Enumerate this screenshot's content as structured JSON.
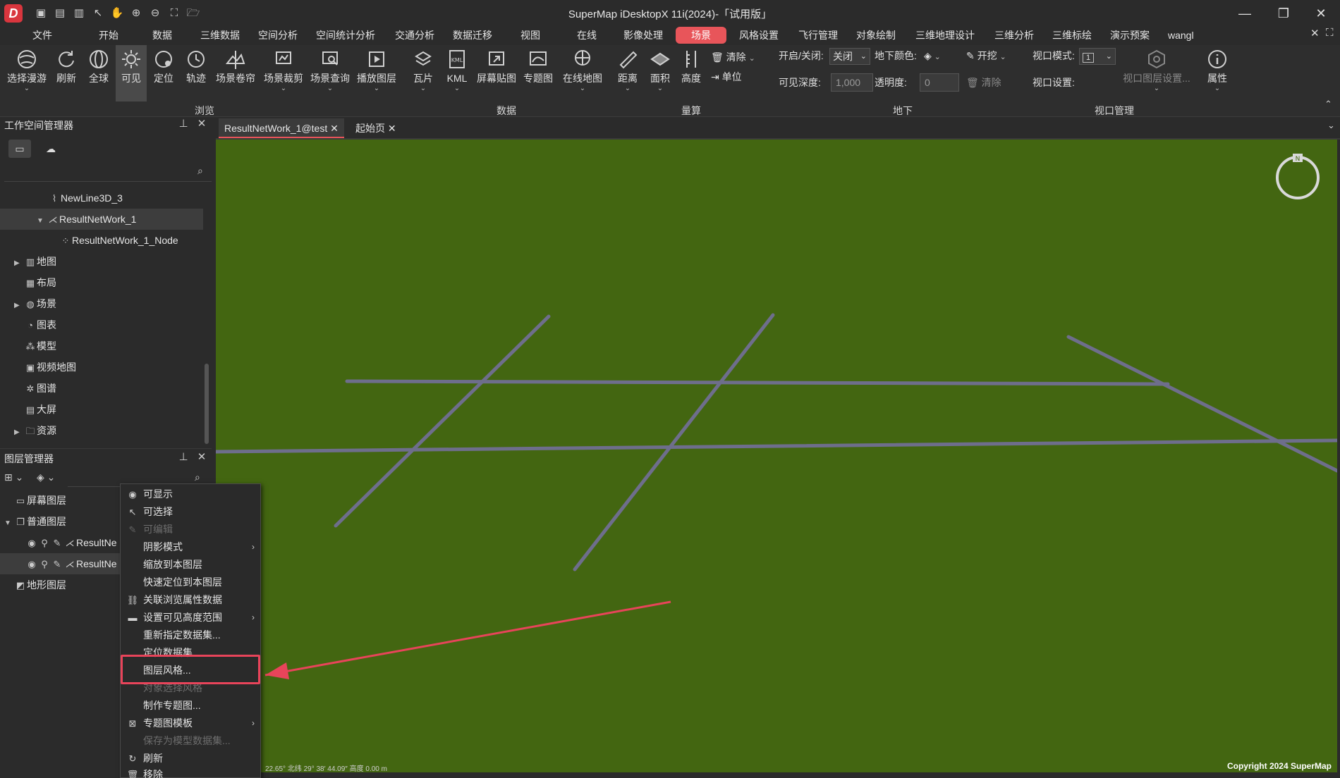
{
  "window": {
    "title": "SuperMap iDesktopX 11i(2024)-「试用版」"
  },
  "menu": {
    "tabs": [
      "文件",
      "开始",
      "数据",
      "三维数据",
      "空间分析",
      "空间统计分析",
      "交通分析",
      "数据迁移",
      "视图",
      "在线",
      "影像处理",
      "场景",
      "风格设置",
      "飞行管理",
      "对象绘制",
      "三维地理设计",
      "三维分析",
      "三维标绘",
      "演示预案"
    ],
    "active": "场景",
    "user": "wangl"
  },
  "ribbon": {
    "browse": {
      "group": "浏览",
      "buttons": [
        "选择漫游",
        "刷新",
        "全球",
        "可见",
        "定位",
        "轨迹",
        "场景卷帘",
        "场景裁剪",
        "场景查询",
        "播放图层"
      ]
    },
    "data": {
      "group": "数据",
      "buttons": [
        "瓦片",
        "KML",
        "屏幕贴图",
        "专题图",
        "在线地图"
      ]
    },
    "measure": {
      "group": "量算",
      "buttons": [
        "距离",
        "面积",
        "高度"
      ],
      "clear": "清除",
      "unit": "单位"
    },
    "underground": {
      "group": "地下",
      "toggle_label": "开启/关闭:",
      "toggle_value": "关闭",
      "color_label": "地下颜色:",
      "excavate": "开挖",
      "depth_label": "可见深度:",
      "depth_value": "1,000",
      "opacity_label": "透明度:",
      "opacity_value": "0",
      "clear": "清除"
    },
    "viewport": {
      "group": "视口管理",
      "mode_label": "视口模式:",
      "mode_value": "1",
      "settings_label": "视口设置:",
      "layer_settings": "视口图层设置..."
    },
    "properties": "属性"
  },
  "workspace": {
    "title": "工作空间管理器",
    "items": [
      "NewLine3D_3",
      "ResultNetWork_1",
      "ResultNetWork_1_Node",
      "地图",
      "布局",
      "场景",
      "图表",
      "模型",
      "视频地图",
      "图谱",
      "大屏",
      "资源"
    ]
  },
  "layers": {
    "title": "图层管理器",
    "items": [
      "屏幕图层",
      "普通图层",
      "ResultNe",
      "ResultNe",
      "地形图层"
    ]
  },
  "tabs": [
    "ResultNetWork_1@test",
    "起始页"
  ],
  "context_menu": {
    "items": [
      "可显示",
      "可选择",
      "可编辑",
      "阴影模式",
      "缩放到本图层",
      "快速定位到本图层",
      "关联浏览属性数据",
      "设置可见高度范围",
      "重新指定数据集...",
      "定位数据集",
      "图层风格...",
      "对象选择风格",
      "制作专题图...",
      "专题图模板",
      "保存为模型数据集...",
      "刷新",
      "移除"
    ]
  },
  "scene": {
    "status": "22.65° 北纬 29° 38′ 44.09″ 高度 0.00 m",
    "copyright": "Copyright 2024 SuperMap",
    "compass": "N",
    "ground_color": "#436611",
    "line_color": "#6e6e8c"
  }
}
